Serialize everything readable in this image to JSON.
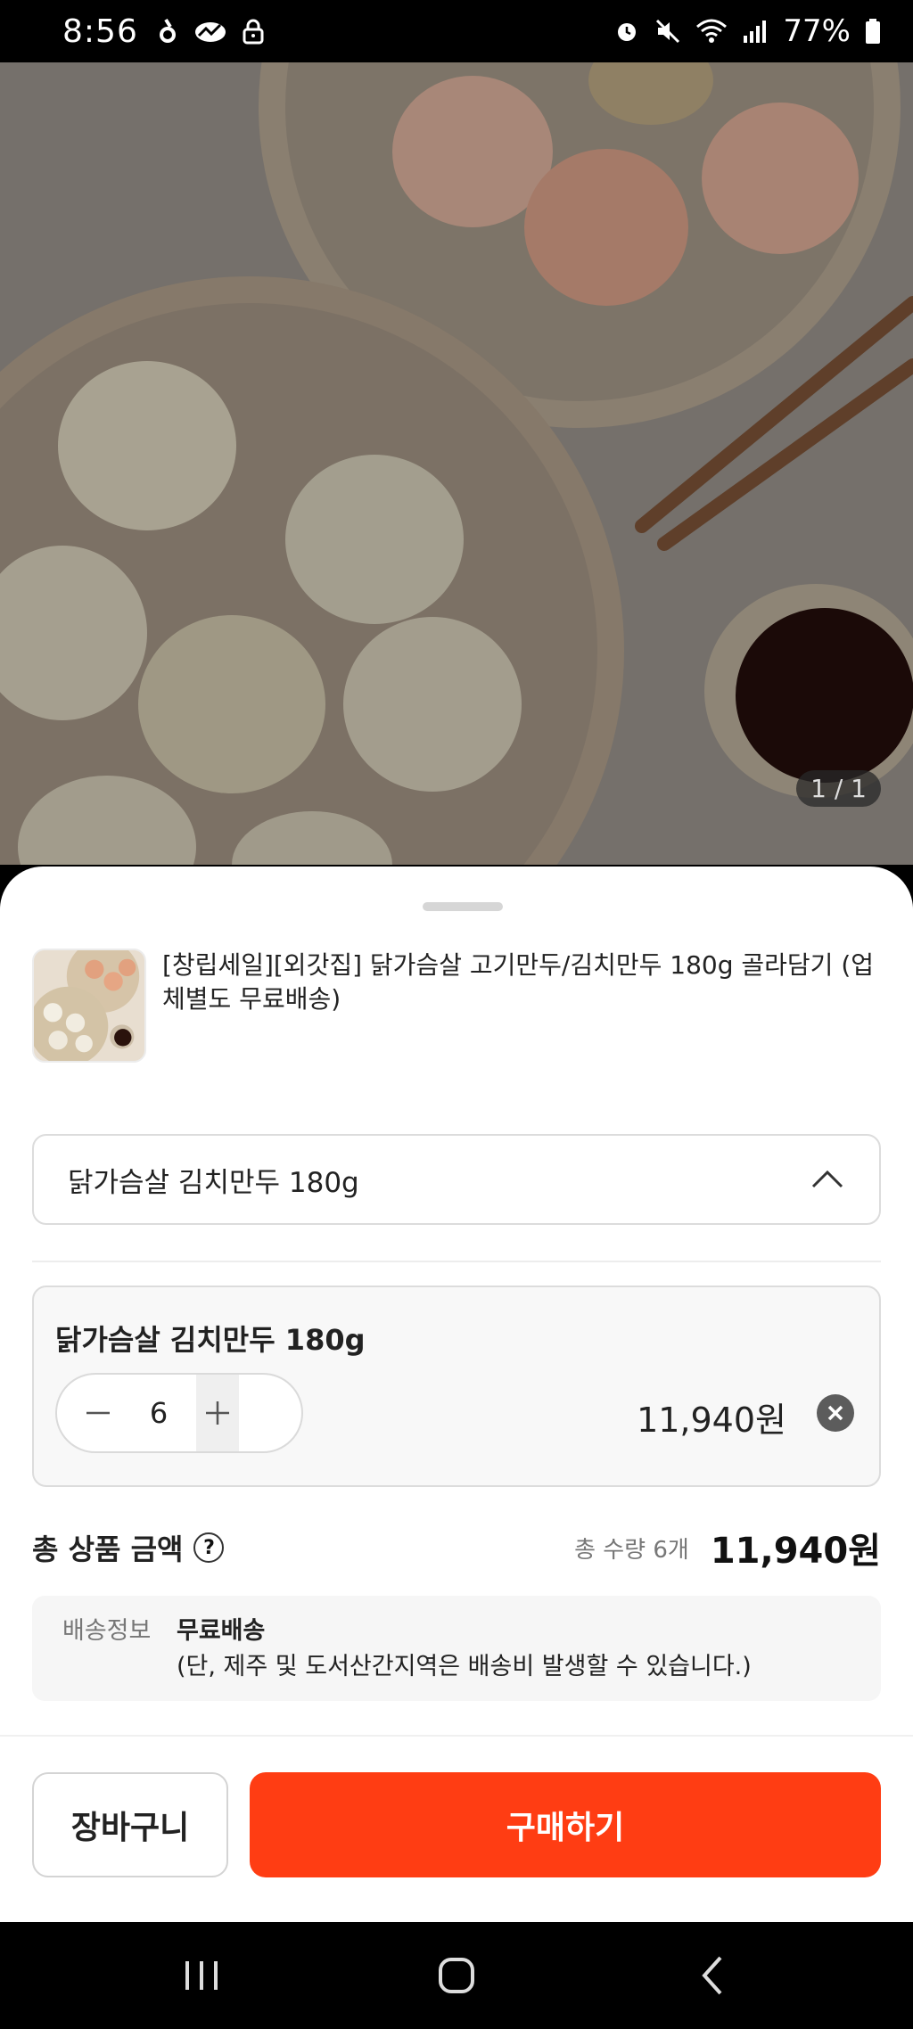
{
  "status_bar": {
    "time": "8:56",
    "battery": "77%",
    "left_icons": [
      "notification-icon",
      "cloud-icon",
      "lock-icon"
    ],
    "right_icons": [
      "alarm-icon",
      "mute-icon",
      "wifi-icon",
      "signal-icon",
      "battery-icon"
    ]
  },
  "hero": {
    "counter": "1 / 1"
  },
  "product": {
    "title": "[창립세일][외갓집] 닭가슴살 고기만두/김치만두 180g 골라담기 (업체별도 무료배송)"
  },
  "option_select": {
    "selected": "닭가슴살 김치만두 180g"
  },
  "selected_item": {
    "name": "닭가슴살 김치만두 180g",
    "quantity": "6",
    "price": "11,940원"
  },
  "total": {
    "label": "총 상품 금액",
    "help": "?",
    "quantity_text": "총 수량 6개",
    "amount": "11,940원"
  },
  "shipping": {
    "label": "배송정보",
    "title": "무료배송",
    "note": "(단, 제주 및 도서산간지역은 배송비 발생할 수 있습니다.)"
  },
  "actions": {
    "cart_label": "장바구니",
    "buy_label": "구매하기"
  },
  "colors": {
    "accent": "#ff3d13",
    "status_bar_bg": "#000000"
  }
}
